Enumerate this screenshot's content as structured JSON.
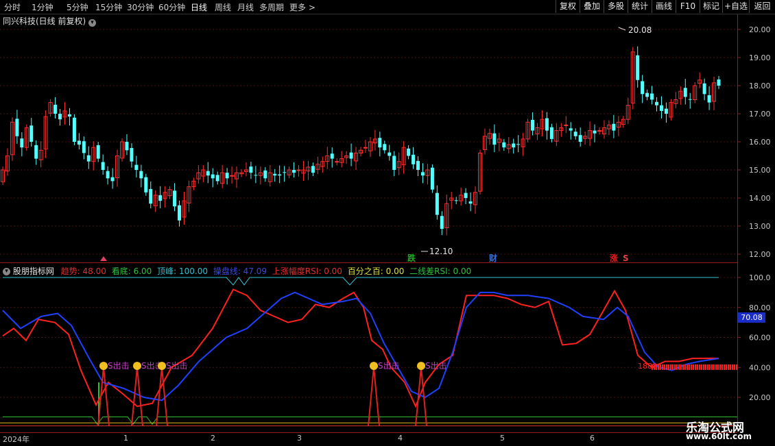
{
  "toolbar": {
    "periods": [
      "分时",
      "1分钟",
      "5分钟",
      "15分钟",
      "30分钟",
      "60分钟",
      "日线",
      "周线",
      "月线",
      "多周期",
      "更多 >"
    ],
    "active_period": "日线",
    "buttons": [
      "复权",
      "叠加",
      "多股",
      "统计",
      "画线",
      "F10",
      "+自选",
      "返回",
      "标记"
    ]
  },
  "stock": {
    "name": "同兴科技(日线 前复权)"
  },
  "main_axis": {
    "ticks": [
      "20.00",
      "19.00",
      "18.00",
      "17.00",
      "16.00",
      "15.00",
      "14.00",
      "13.00",
      "12.00"
    ]
  },
  "annotations": {
    "high": "20.08",
    "low": "12.10"
  },
  "markers": [
    {
      "text": "跌",
      "color": "#22aa22"
    },
    {
      "text": "财",
      "color": "#3b6fd8"
    },
    {
      "text": "涨",
      "color": "#d02020"
    },
    {
      "text": "S",
      "color": "#e04040"
    }
  ],
  "indicator": {
    "name": "股朋指标网",
    "values": [
      {
        "label": "趋势: 48.00",
        "color": "#e03030"
      },
      {
        "label": "看底: 6.00",
        "color": "#30c040"
      },
      {
        "label": "顶峰: 100.00",
        "color": "#30c0d0"
      },
      {
        "label": "操盘线: 47.09",
        "color": "#3a4ae0"
      },
      {
        "label": "上涨幅度RSI: 0.00",
        "color": "#e03030"
      },
      {
        "label": "百分之百: 0.00",
        "color": "#e0e040"
      },
      {
        "label": "二线差RSI: 0.00",
        "color": "#30c040"
      }
    ],
    "signal_label": "S出击",
    "signal_label_partial": "1888",
    "current_value": "70.08",
    "ticks": [
      "100.0",
      "80.00",
      "60.00",
      "40.00",
      "20.00"
    ]
  },
  "time_axis": [
    "2024年",
    "1",
    "2",
    "3",
    "4",
    "5",
    "6"
  ],
  "watermark": {
    "line1": "乐淘公式网",
    "line2": "www.60lt.com"
  },
  "colors": {
    "up": "#ff3030",
    "down": "#54ffff",
    "trend": "#ff2020",
    "opline": "#2040ff",
    "peak": "#30c8d8",
    "bottom": "#30c030"
  }
}
